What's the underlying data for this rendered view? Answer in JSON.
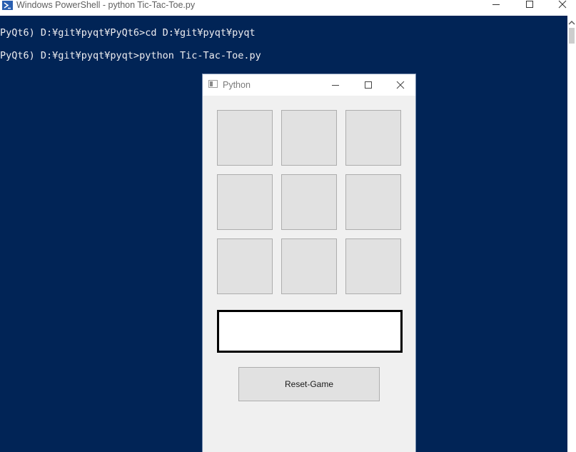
{
  "powershell": {
    "title": "Windows PowerShell - python  Tic-Tac-Toe.py",
    "lines": [
      "PyQt6) D:¥git¥pyqt¥PyQt6>cd D:¥git¥pyqt¥pyqt",
      "PyQt6) D:¥git¥pyqt¥pyqt>python Tic-Tac-Toe.py"
    ]
  },
  "python_window": {
    "title": "Python",
    "cells": [
      "",
      "",
      "",
      "",
      "",
      "",
      "",
      "",
      ""
    ],
    "status_text": "",
    "reset_label": "Reset-Game"
  },
  "colors": {
    "console_background": "#012456",
    "console_text": "#eeedf0",
    "window_background": "#f0f0f0",
    "button_face": "#e1e1e1"
  }
}
